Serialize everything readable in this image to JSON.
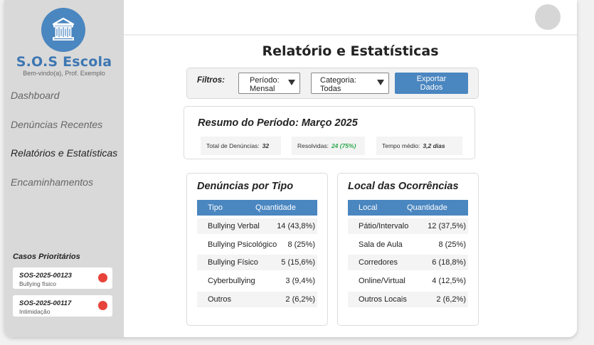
{
  "sidebar": {
    "brand": "S.O.S Escola",
    "welcome": "Bem-vindo(a), Prof. Exemplo",
    "nav": [
      {
        "label": "Dashboard"
      },
      {
        "label": "Denúncias Recentes"
      },
      {
        "label": "Relatórios e Estatísticas",
        "active": true
      },
      {
        "label": "Encaminhamentos"
      }
    ],
    "priority_title": "Casos Prioritários",
    "cases": [
      {
        "id": "SOS-2025-00123",
        "desc": "Bullying físico",
        "status_color": "#e8433a"
      },
      {
        "id": "SOS-2025-00117",
        "desc": "Intimidação",
        "status_color": "#e8433a"
      }
    ]
  },
  "page": {
    "title": "Relatório e Estatísticas"
  },
  "filters": {
    "label": "Filtros:",
    "period": {
      "line1": "Período:",
      "line2": "Mensal"
    },
    "category": {
      "line1": "Categoria:",
      "line2": "Todas"
    },
    "export": {
      "line1": "Exportar",
      "line2": "Dados"
    }
  },
  "summary": {
    "title": "Resumo do Período: Março 2025",
    "stats": [
      {
        "label": "Total de Denúncias:",
        "value": "32"
      },
      {
        "label": "Resolvidas:",
        "value": "24 (75%)"
      },
      {
        "label": "Tempo médio:",
        "value": "3,2 dias"
      }
    ]
  },
  "by_type": {
    "title": "Denúncias por Tipo",
    "headers": [
      "Tipo",
      "Quantidade"
    ],
    "rows": [
      [
        "Bullying Verbal",
        "14 (43,8%)"
      ],
      [
        "Bullying Psicológico",
        "8 (25%)"
      ],
      [
        "Bullying Físico",
        "5 (15,6%)"
      ],
      [
        "Cyberbullying",
        "3 (9,4%)"
      ],
      [
        "Outros",
        "2 (6,2%)"
      ]
    ]
  },
  "by_location": {
    "title": "Local das Ocorrências",
    "headers": [
      "Local",
      "Quantidade"
    ],
    "rows": [
      [
        "Pátio/Intervalo",
        "12 (37,5%)"
      ],
      [
        "Sala de Aula",
        "8 (25%)"
      ],
      [
        "Corredores",
        "6 (18,8%)"
      ],
      [
        "Online/Virtual",
        "4 (12,5%)"
      ],
      [
        "Outros Locais",
        "2 (6,2%)"
      ]
    ]
  },
  "colors": {
    "accent": "#4a86c0",
    "success": "#2fa84f",
    "alert": "#e8433a"
  }
}
